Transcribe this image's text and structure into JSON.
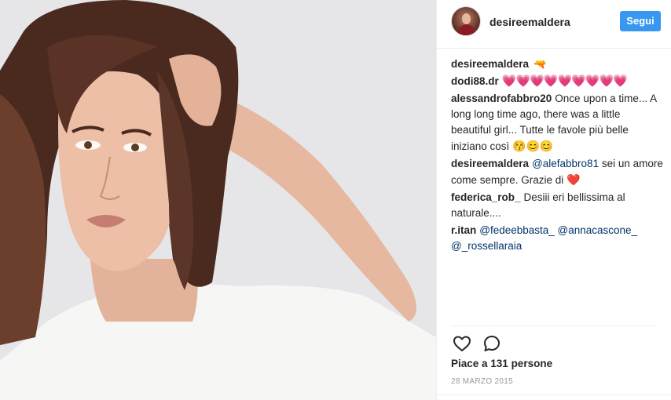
{
  "post": {
    "author": {
      "username": "desireemaldera",
      "follow_label": "Segui"
    },
    "caption": {
      "username": "desireemaldera",
      "emoji": "🔫"
    },
    "comments": [
      {
        "username": "dodi88.dr",
        "hearts": "💗💗💗💗💗💗💗💗💗"
      },
      {
        "username": "alessandrofabbro20",
        "text": "Once upon a time... A long long time ago, there was a little beautiful girl... Tutte le favole più belle iniziano così",
        "emoji": "😚😊😊"
      },
      {
        "username": "desireemaldera",
        "mention": "@alefabbro81",
        "text": "sei un amore come sempre. Grazie di",
        "emoji": "❤️"
      },
      {
        "username": "federica_rob_",
        "text": "Desiii eri bellissima al naturale...."
      },
      {
        "username": "r.itan",
        "mentions": "@fedeebbasta_ @annacascone_ @_rossellaraia"
      }
    ],
    "likes_text": "Piace a 131 persone",
    "date": "28 MARZO 2015",
    "icons": {
      "like": "heart-outline-icon",
      "comment": "speech-bubble-icon"
    },
    "colors": {
      "follow_button": "#3897f0",
      "mention": "#003569",
      "date": "#999999"
    }
  }
}
